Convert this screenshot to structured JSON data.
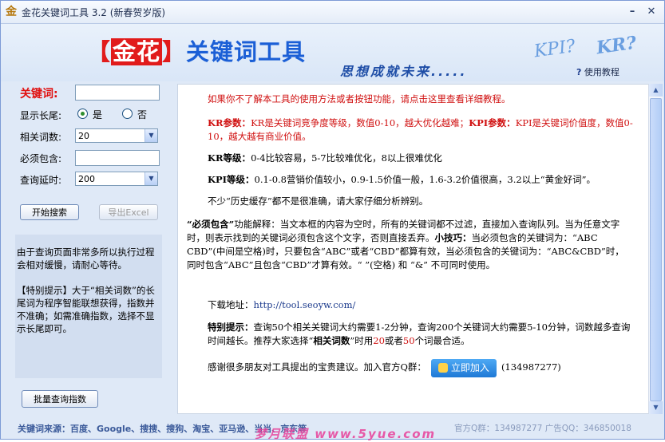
{
  "window": {
    "app_icon": "金",
    "title": "金花关键词工具 3.2 (新春贺岁版)",
    "minimize": "–",
    "close": "✕"
  },
  "banner": {
    "logo_bracket_left": "【",
    "logo_hua": "金花",
    "logo_bracket_right": "】",
    "logo_rest": "关键词工具",
    "slogan": "思想成就未来.....",
    "kpi": "KPI?",
    "kr": "KR?",
    "help_q": "?",
    "help_label": "使用教程"
  },
  "form": {
    "keyword_label": "关键词:",
    "keyword_value": "",
    "longtail_label": "显示长尾:",
    "yes": "是",
    "no": "否",
    "yes_selected": true,
    "related_label": "相关词数:",
    "related_value": "20",
    "include_label": "必须包含:",
    "include_value": "",
    "delay_label": "查询延时:",
    "delay_value": "200",
    "search_button": "开始搜索",
    "export_button": "导出Excel"
  },
  "note": {
    "p1": "由于查询页面非常多所以执行过程会相对缓慢，请耐心等待。",
    "p2": "【特别提示】大于“相关词数”的长尾词为程序智能联想获得，指数并不准确；如需准确指数，选择不显示长尾即可。"
  },
  "batch_button": "批量查询指数",
  "main": {
    "intro": "如果你不了解本工具的使用方法或者按钮功能，请点击这里查看详细教程。",
    "kr_label": "KR参数：",
    "kr_text": "KR是关键词竞争度等级，数值0-10，越大优化越难；",
    "kpi_label": "KPI参数：",
    "kpi_text": "KPI是关键词价值度，数值0-10，越大越有商业价值。",
    "krlevel_label": "KR等级：",
    "krlevel_text": "0-4比较容易，5-7比较难优化，8以上很难优化",
    "kpilevel_label": "KPI等级：",
    "kpilevel_text": "0.1-0.8营销价值较小，0.9-1.5价值一般，1.6-3.2价值很高，3.2以上“黄金好词”。",
    "cache_note": "不少“历史缓存”都不是很准确，请大家仔细分析辨别。",
    "must_label": "“必须包含”",
    "must_text_a": "功能解释：当文本框的内容为空时，所有的关键词都不过滤，直接加入查询队列。当为任意文字时，则表示找到的关键词必须包含这个文字，否则直接丢弃。",
    "tip_label": "小技巧：",
    "tip_text": "当必须包含的关键词为：“ABC CBD”(中间是空格)时，只要包含“ABC”或者“CBD”都算有效，当必须包含的关键词为：“ABC&CBD”时，同时包含“ABC”且包含“CBD”才算有效。“ ”(空格) 和 “&” 不可同时使用。",
    "download_label": "下载地址：",
    "download_url": "http://tool.seoyw.com/",
    "special_label": "特别提示：",
    "special_a": "查询50个相关关键词大约需要1-2分钟，查询200个关键词大约需要5-10分钟，词数越多查询时间越长。推荐大家选择“",
    "special_b": "相关词数",
    "special_c": "”时用",
    "special_20": "20",
    "special_or": "或者",
    "special_50": "50",
    "special_d": "个词最合适。",
    "thanks": "感谢很多朋友对工具提出的宝贵建议。加入官方Q群：",
    "join_button": "立即加入",
    "qq_group": "(134987277)"
  },
  "footer": {
    "sources": "关键词来源：百度、Google、搜搜、搜狗、淘宝、亚马逊、当当、京东等",
    "contact": "官方Q群：134987277  广告QQ：346850018",
    "watermark": "梦月联盟 www.5yue.com"
  },
  "colors": {
    "accent_red": "#d01010",
    "accent_blue": "#1b5fd6"
  },
  "icons": [
    "app-logo-icon",
    "minimize-icon",
    "close-icon",
    "help-icon",
    "dropdown-arrow-icon",
    "qq-icon"
  ]
}
